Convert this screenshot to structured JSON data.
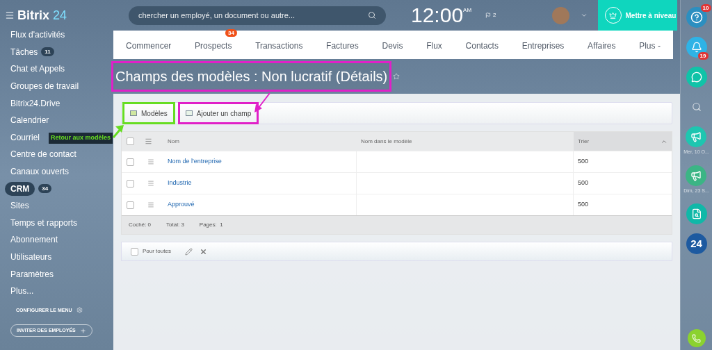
{
  "header": {
    "logo": "Bitrix",
    "logo_accent": "24",
    "search_placeholder": "chercher un employé, un document ou autre...",
    "time": "12:00",
    "time_suffix": "AM",
    "flag_count": "2",
    "upgrade": "Mettre à niveau"
  },
  "sidebar": {
    "items": [
      {
        "label": "Flux d'activités",
        "selected": false
      },
      {
        "label": "Tâches",
        "badge": "11",
        "selected": false
      },
      {
        "label": "Chat et Appels",
        "selected": false
      },
      {
        "label": "Groupes de travail",
        "selected": false
      },
      {
        "label": "Bitrix24.Drive",
        "selected": false
      },
      {
        "label": "Calendrier",
        "selected": false
      },
      {
        "label": "Courriel",
        "selected": false
      },
      {
        "label": "Centre de contact",
        "selected": false
      },
      {
        "label": "Canaux ouverts",
        "selected": false
      },
      {
        "label": "CRM",
        "badge": "34",
        "selected": true
      },
      {
        "label": "Sites",
        "selected": false
      },
      {
        "label": "Temps et rapports",
        "selected": false
      },
      {
        "label": "Abonnement",
        "selected": false
      },
      {
        "label": "Utilisateurs",
        "selected": false
      },
      {
        "label": "Paramètres",
        "selected": false
      },
      {
        "label": "Plus...",
        "selected": false
      }
    ],
    "configure": "CONFIGURER LE MENU",
    "invite": "INVITER DES EMPLOYÉS"
  },
  "nav_tabs": [
    {
      "label": "Commencer"
    },
    {
      "label": "Prospects",
      "badge": "34"
    },
    {
      "label": "Transactions"
    },
    {
      "label": "Factures"
    },
    {
      "label": "Devis"
    },
    {
      "label": "Flux"
    },
    {
      "label": "Contacts"
    },
    {
      "label": "Entreprises"
    },
    {
      "label": "Affaires"
    },
    {
      "label": "Plus -"
    }
  ],
  "page_title": {
    "text": "Champs des modèles : Non lucratif (Détails)",
    "color": "#e020c8"
  },
  "toolbar": [
    {
      "label": "Modèles",
      "kind": "back",
      "color": "#66dd22"
    },
    {
      "label": "Ajouter un champ",
      "kind": "add",
      "color": "#e020c8"
    }
  ],
  "annotation": {
    "text": "Retour aux modèles",
    "color": "#66dd22"
  },
  "table": {
    "all_checked": false,
    "columns": [
      {
        "label": "Nom",
        "sorted": false
      },
      {
        "label": "Nom dans le modèle",
        "sorted": false
      },
      {
        "label": "Trier",
        "sorted": true
      }
    ],
    "rows": [
      {
        "name": "Nom de l'entreprise",
        "sort": "500",
        "checked": false
      },
      {
        "name": "Industrie",
        "sort": "500",
        "checked": false
      },
      {
        "name": "Approuvé",
        "sort": "500",
        "checked": false
      }
    ],
    "footer": [
      "Coché: 0",
      "Total: 3",
      "Pages:  1"
    ]
  },
  "action_bar": {
    "label": "Pour toutes",
    "checked": false
  },
  "right_bar": [
    {
      "kind": "help",
      "badge": "10"
    },
    {
      "kind": "bell",
      "badge": "19"
    },
    {
      "kind": "chat"
    },
    {
      "kind": "search"
    },
    {
      "kind": "megaphone",
      "caption": "Mer, 10 O...",
      "color": "#1ec6b0"
    },
    {
      "kind": "megaphone",
      "caption": "Dim, 23 S...",
      "color": "#3bb585"
    },
    {
      "kind": "doc-search"
    },
    {
      "kind": "logo",
      "text": "24"
    }
  ]
}
